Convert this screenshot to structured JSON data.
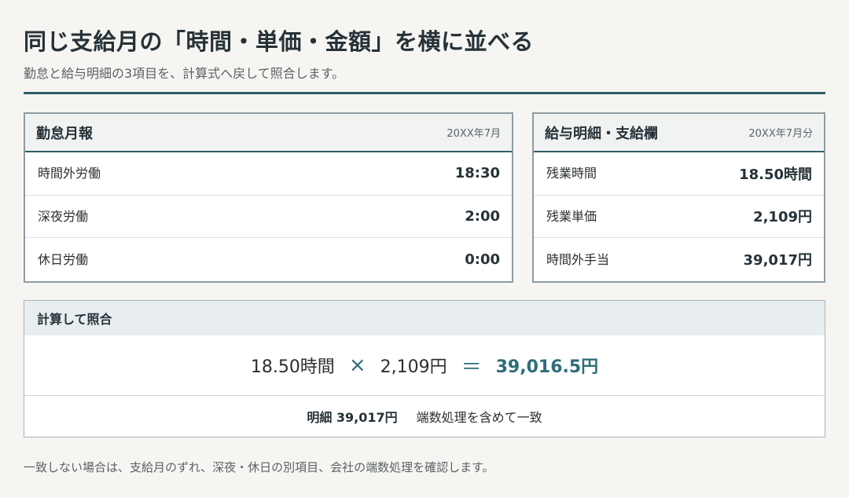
{
  "header": {
    "title": "同じ支給月の「時間・単価・金額」を横に並べる",
    "subtitle": "勤怠と給与明細の3項目を、計算式へ戻して照合します。"
  },
  "attendance_card": {
    "title": "勤怠月報",
    "period": "20XX年7月",
    "rows": [
      {
        "label": "時間外労働",
        "value": "18:30"
      },
      {
        "label": "深夜労働",
        "value": "2:00"
      },
      {
        "label": "休日労働",
        "value": "0:00"
      }
    ]
  },
  "payslip_card": {
    "title": "給与明細・支給欄",
    "period": "20XX年7月分",
    "rows": [
      {
        "label": "残業時間",
        "value": "18.50時間"
      },
      {
        "label": "残業単価",
        "value": "2,109円"
      },
      {
        "label": "時間外手当",
        "value": "39,017円"
      }
    ]
  },
  "calculation": {
    "title": "計算して照合",
    "hours": "18.50時間",
    "multiply": "×",
    "rate": "2,109円",
    "equals": "＝",
    "result": "39,016.5円",
    "footer_amount": "明細 39,017円",
    "footer_note": "端数処理を含めて一致"
  },
  "footer_note": "一致しない場合は、支給月のずれ、深夜・休日の別項目、会社の端数処理を確認します。",
  "colors": {
    "accent": "#2e5e68",
    "background": "#f6f5f2"
  }
}
